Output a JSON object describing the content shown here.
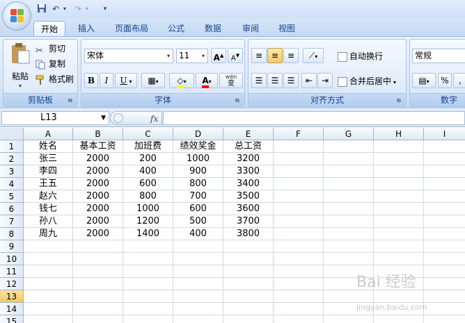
{
  "tabs": [
    "开始",
    "插入",
    "页面布局",
    "公式",
    "数据",
    "审阅",
    "视图"
  ],
  "clipboard": {
    "paste": "粘贴",
    "cut": "剪切",
    "copy": "复制",
    "format_painter": "格式刷",
    "label": "剪贴板"
  },
  "font": {
    "name": "宋体",
    "size": "11",
    "grow": "A",
    "shrink": "A",
    "bold": "B",
    "italic": "I",
    "underline": "U",
    "phonetic": "wén",
    "phonetic_char": "变",
    "label": "字体",
    "fill_color": "#ffff00",
    "font_color": "#ff0000"
  },
  "alignment": {
    "wrap": "自动换行",
    "merge": "合并后居中",
    "label": "对齐方式"
  },
  "number": {
    "format": "常规",
    "percent": "%",
    "label": "数字"
  },
  "formula_bar": {
    "name_box": "L13",
    "fx": "fx",
    "formula": ""
  },
  "columns": [
    "A",
    "B",
    "C",
    "D",
    "E",
    "F",
    "G",
    "H",
    "I"
  ],
  "rows": [
    "1",
    "2",
    "3",
    "4",
    "5",
    "6",
    "7",
    "8",
    "9",
    "10",
    "11",
    "12",
    "13",
    "14",
    "15"
  ],
  "selected_row": "13",
  "sheet": [
    [
      "姓名",
      "基本工资",
      "加班费",
      "绩效奖金",
      "总工资"
    ],
    [
      "张三",
      "2000",
      "200",
      "1000",
      "3200"
    ],
    [
      "李四",
      "2000",
      "400",
      "900",
      "3300"
    ],
    [
      "王五",
      "2000",
      "600",
      "800",
      "3400"
    ],
    [
      "赵六",
      "2000",
      "800",
      "700",
      "3500"
    ],
    [
      "钱七",
      "2000",
      "1000",
      "600",
      "3600"
    ],
    [
      "孙八",
      "2000",
      "1200",
      "500",
      "3700"
    ],
    [
      "周九",
      "2000",
      "1400",
      "400",
      "3800"
    ]
  ],
  "watermark": {
    "line1": "Bai 经验",
    "line2": "jingyan.baidu.com"
  }
}
